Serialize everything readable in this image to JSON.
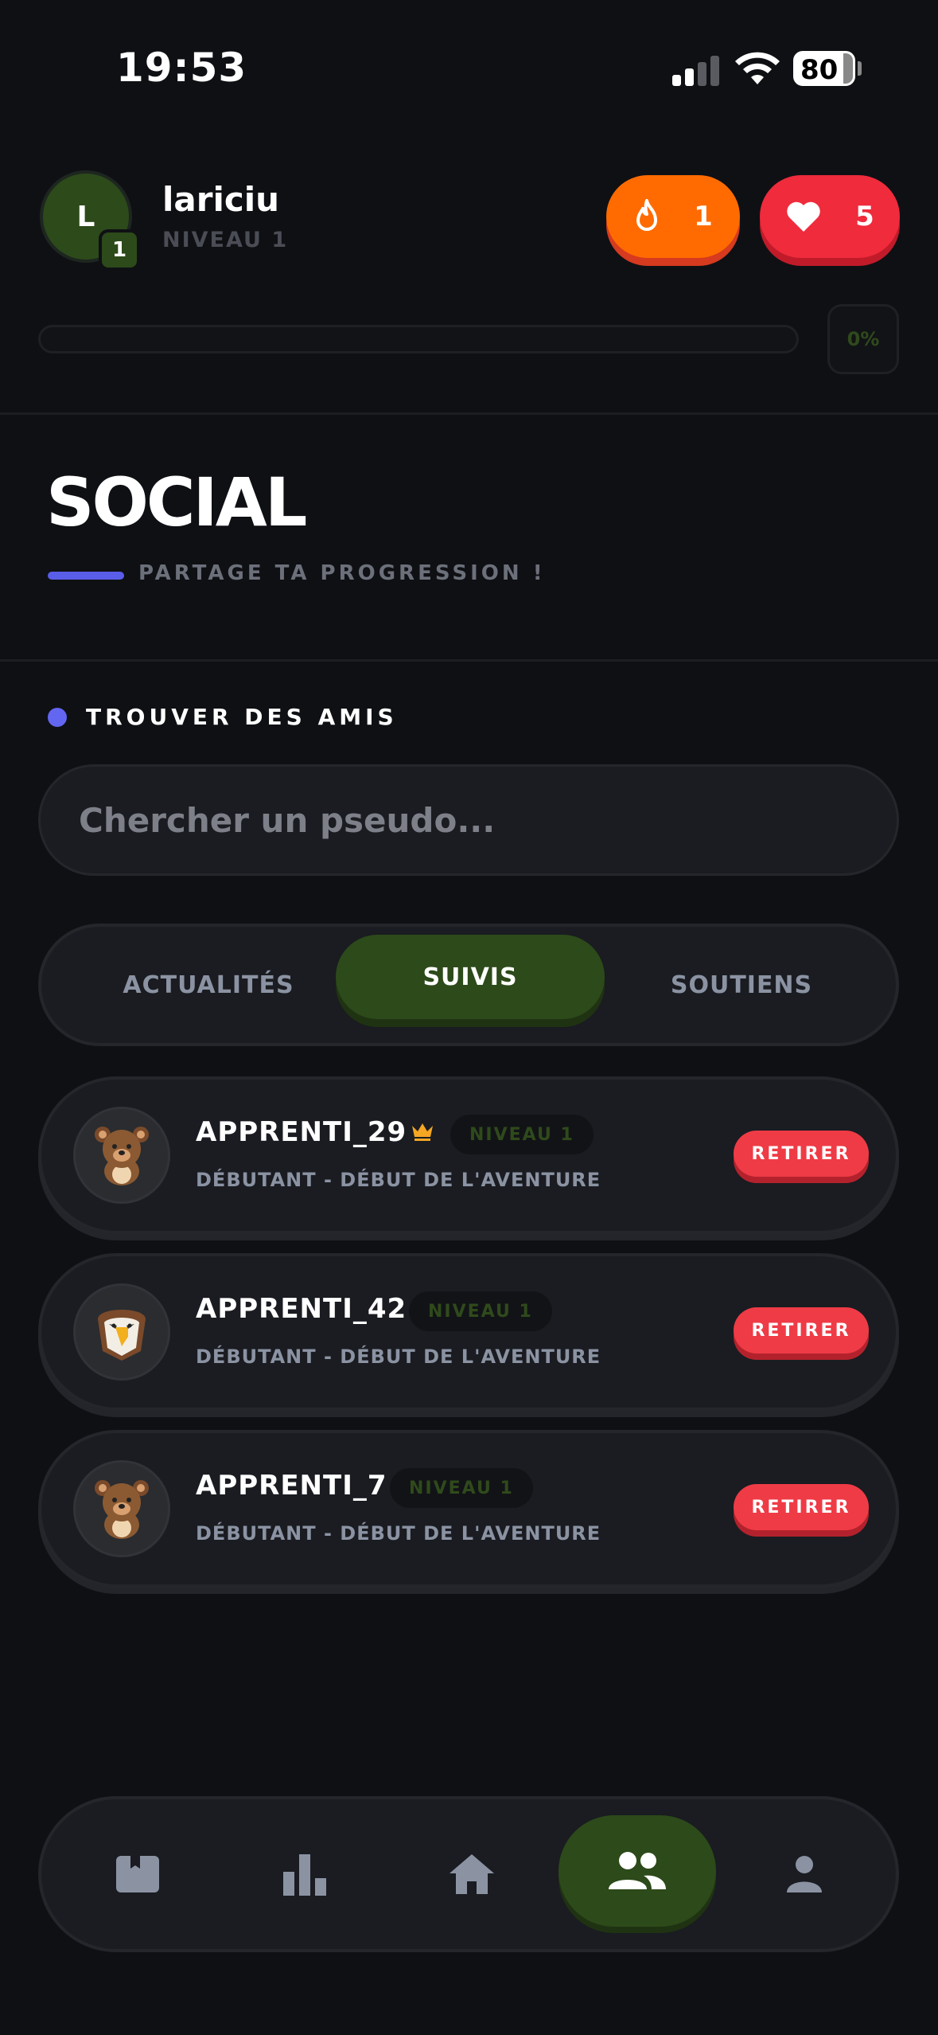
{
  "status_bar": {
    "time": "19:53",
    "battery": "80"
  },
  "header": {
    "avatar_initial": "L",
    "avatar_level": "1",
    "username": "lariciu",
    "level_label": "NIVEAU 1",
    "streak_count": "1",
    "lives_count": "5",
    "xp_percent_label": "0%",
    "xp_progress": 0
  },
  "page": {
    "title": "SOCIAL",
    "subtitle": "PARTAGE TA PROGRESSION !"
  },
  "find_friends": {
    "label": "TROUVER DES AMIS",
    "placeholder": "Chercher un pseudo..."
  },
  "tabs": [
    {
      "label": "ACTUALITÉS",
      "active": false
    },
    {
      "label": "SUIVIS",
      "active": true
    },
    {
      "label": "SOUTIENS",
      "active": false
    }
  ],
  "friends": [
    {
      "name": "APPRENTI_29",
      "crown": true,
      "level": "NIVEAU 1",
      "subtitle": "DÉBUTANT - DÉBUT DE L'AVENTURE",
      "avatar": "bear-icon",
      "action": "RETIRER"
    },
    {
      "name": "APPRENTI_42",
      "crown": false,
      "level": "NIVEAU 1",
      "subtitle": "DÉBUTANT - DÉBUT DE L'AVENTURE",
      "avatar": "eagle-icon",
      "action": "RETIRER"
    },
    {
      "name": "APPRENTI_7",
      "crown": false,
      "level": "NIVEAU 1",
      "subtitle": "DÉBUTANT - DÉBUT DE L'AVENTURE",
      "avatar": "bear-icon",
      "action": "RETIRER"
    }
  ],
  "bottom_nav": [
    {
      "icon": "lesson-card-icon",
      "active": false
    },
    {
      "icon": "leaderboard-icon",
      "active": false
    },
    {
      "icon": "home-icon",
      "active": false
    },
    {
      "icon": "friends-icon",
      "active": true
    },
    {
      "icon": "profile-icon",
      "active": false
    }
  ],
  "colors": {
    "background": "#0f1014",
    "accent_green": "#2d4a1a",
    "streak_orange": "#ff6b00",
    "lives_red": "#ef2b3c",
    "accent_indigo": "#6366f1",
    "remove_red": "#ef3b46"
  }
}
